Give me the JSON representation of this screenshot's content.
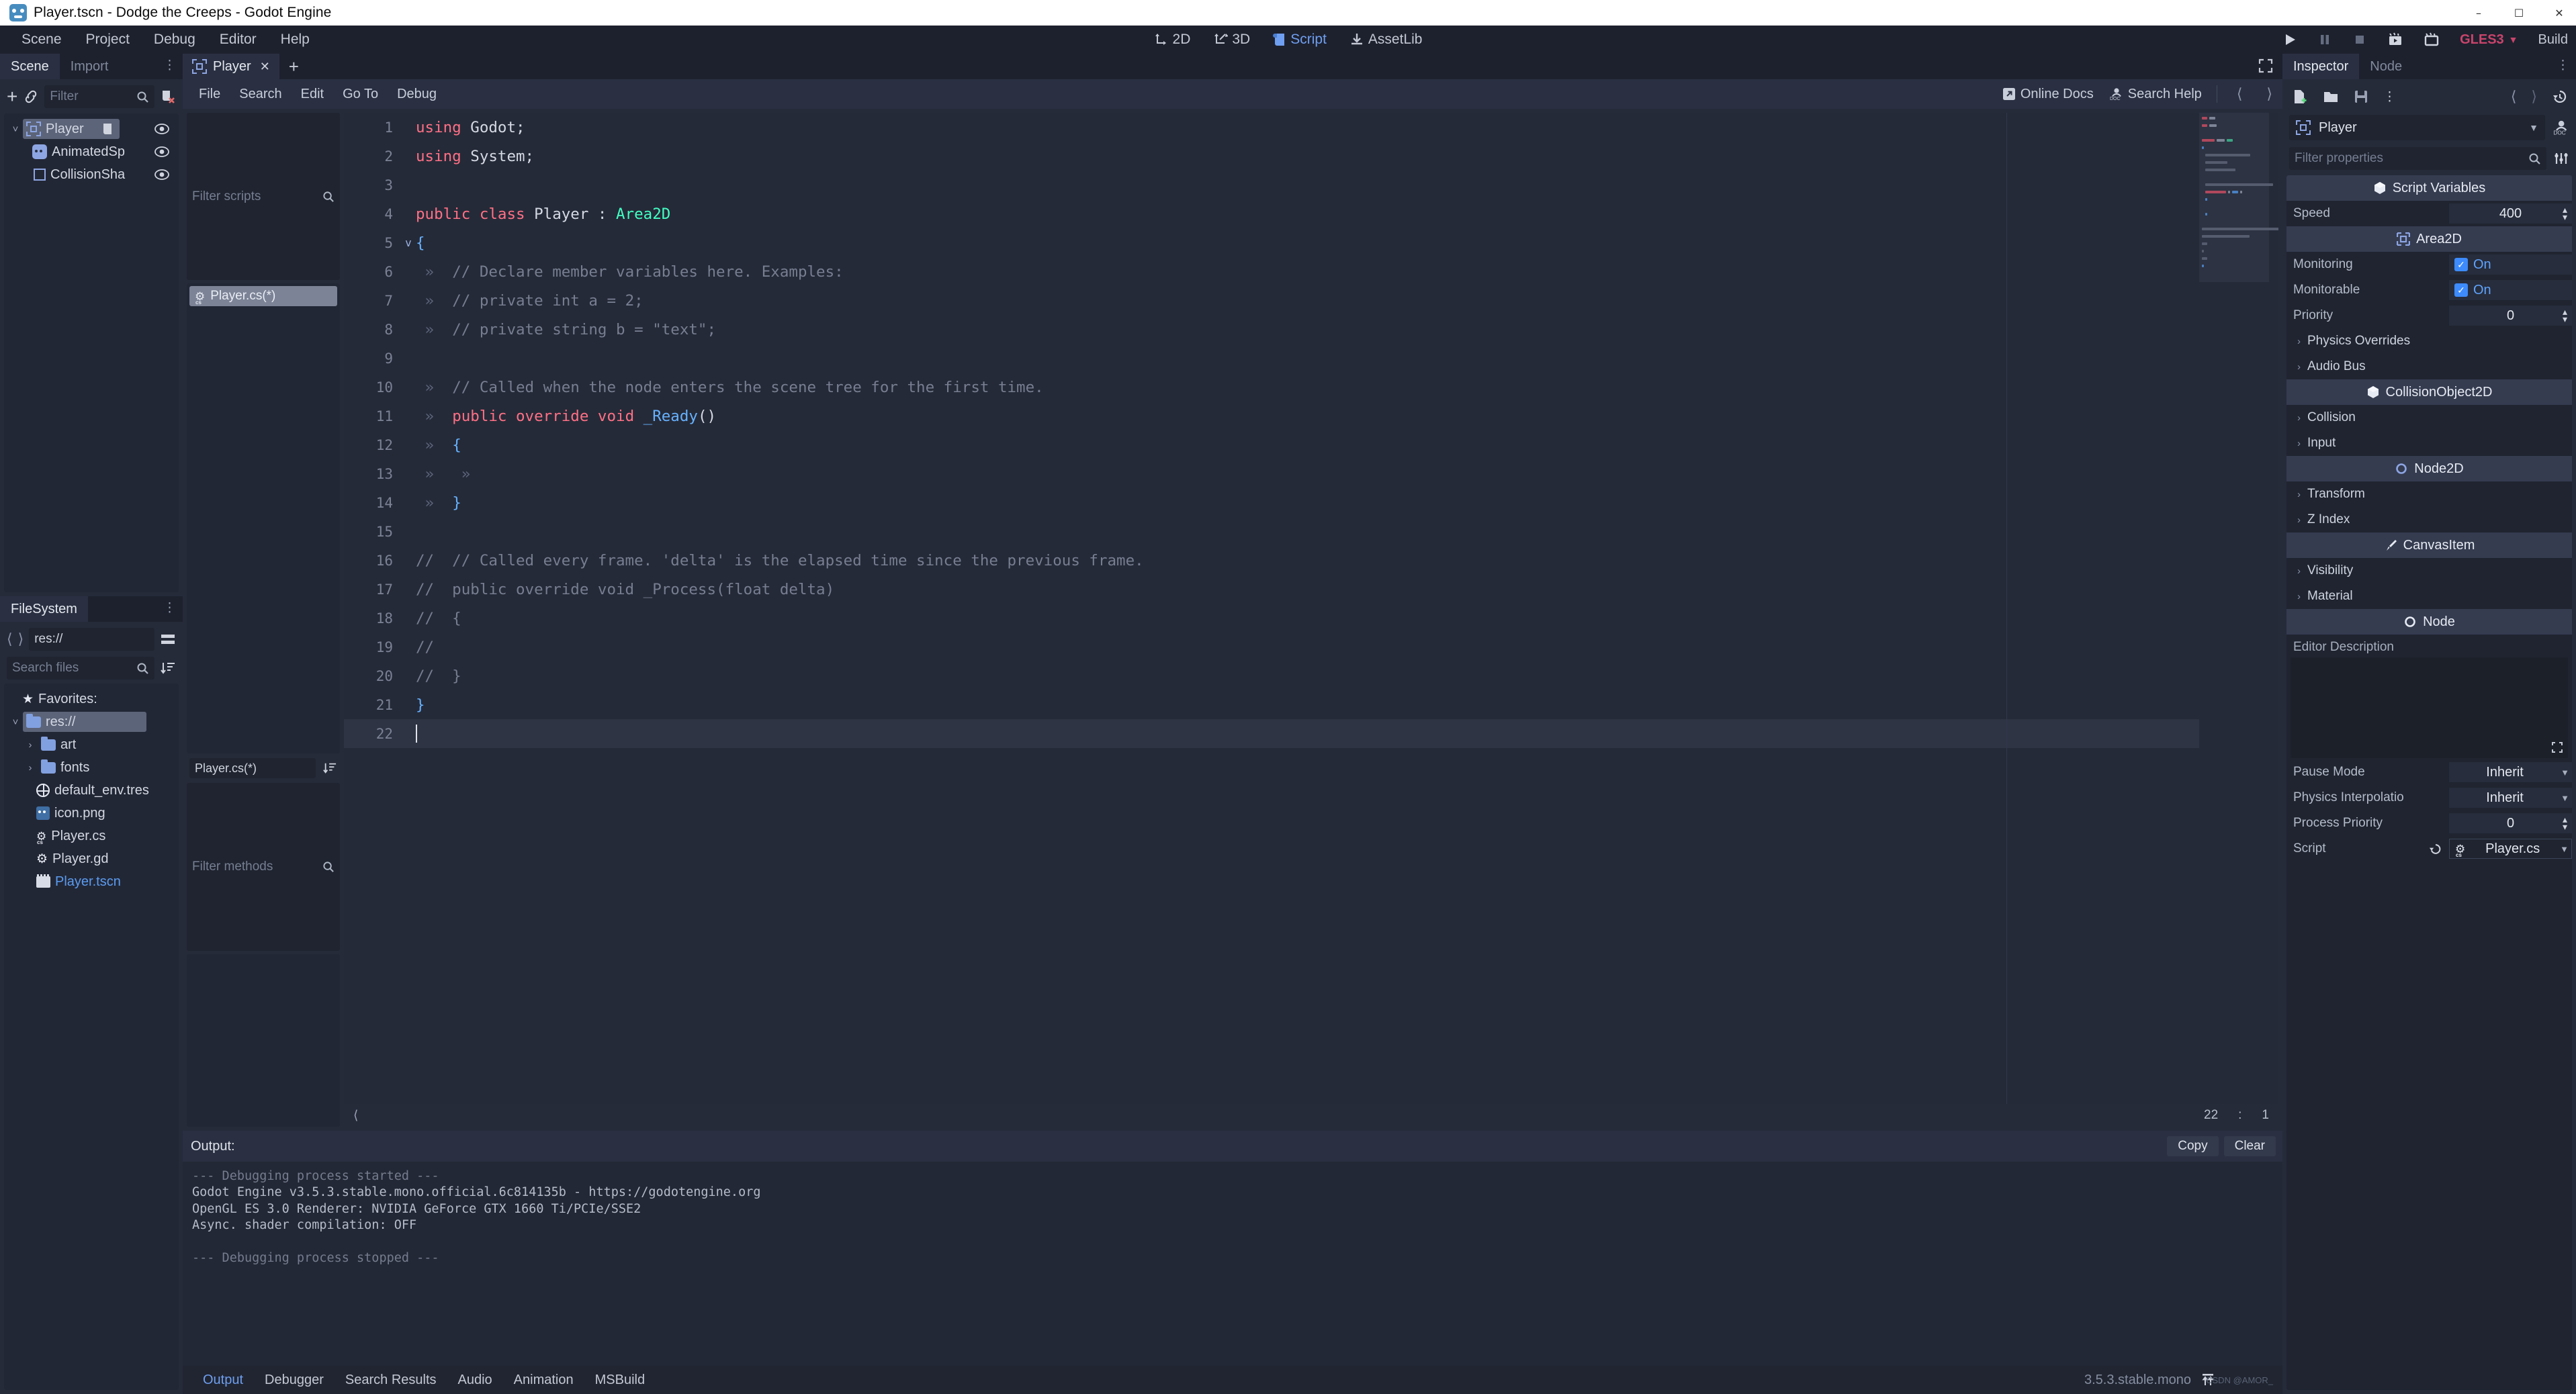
{
  "window": {
    "title": "Player.tscn - Dodge the Creeps - Godot Engine",
    "minimize": "–",
    "maximize": "☐",
    "close": "✕"
  },
  "menubar": {
    "items": [
      "Scene",
      "Project",
      "Debug",
      "Editor",
      "Help"
    ],
    "modes": [
      {
        "label": "2D",
        "icon": "move-2d-icon",
        "active": false
      },
      {
        "label": "3D",
        "icon": "move-3d-icon",
        "active": false
      },
      {
        "label": "Script",
        "icon": "script-icon",
        "active": true
      },
      {
        "label": "AssetLib",
        "icon": "download-icon",
        "active": false
      }
    ],
    "play_controls": [
      {
        "name": "play-button",
        "glyph": "▶"
      },
      {
        "name": "pause-button",
        "glyph": "▐▌"
      },
      {
        "name": "stop-button",
        "glyph": "■"
      },
      {
        "name": "play-scene-button",
        "glyph": "▶"
      },
      {
        "name": "play-custom-scene-button",
        "glyph": "□"
      }
    ],
    "renderer": "GLES3",
    "build_label": "Build"
  },
  "scene_dock": {
    "tabs": [
      {
        "label": "Scene",
        "active": true
      },
      {
        "label": "Import",
        "active": false
      }
    ],
    "filter_placeholder": "Filter",
    "nodes": [
      {
        "label": "Player",
        "icon": "area2d-icon",
        "selected": true,
        "depth": 0,
        "has_script": true
      },
      {
        "label": "AnimatedSp",
        "icon": "animated-sprite-icon",
        "selected": false,
        "depth": 1,
        "has_script": false
      },
      {
        "label": "CollisionSha",
        "icon": "collision-shape-icon",
        "selected": false,
        "depth": 1,
        "has_script": false
      }
    ]
  },
  "filesystem_dock": {
    "tab": "FileSystem",
    "path": "res://",
    "search_placeholder": "Search files",
    "favorites_label": "Favorites:",
    "entries": [
      {
        "label": "res://",
        "type": "folder",
        "depth": 0,
        "selected": true,
        "expanded": true
      },
      {
        "label": "art",
        "type": "folder",
        "depth": 1,
        "selected": false,
        "expanded": false
      },
      {
        "label": "fonts",
        "type": "folder",
        "depth": 1,
        "selected": false,
        "expanded": false
      },
      {
        "label": "default_env.tres",
        "type": "resource",
        "depth": 1,
        "selected": false
      },
      {
        "label": "icon.png",
        "type": "image",
        "depth": 1,
        "selected": false
      },
      {
        "label": "Player.cs",
        "type": "csharp",
        "depth": 1,
        "selected": false
      },
      {
        "label": "Player.gd",
        "type": "gdscript",
        "depth": 1,
        "selected": false
      },
      {
        "label": "Player.tscn",
        "type": "scene",
        "depth": 1,
        "selected": false,
        "highlight": true
      }
    ]
  },
  "script_editor": {
    "tab_label": "Player",
    "menus": [
      "File",
      "Search",
      "Edit",
      "Go To",
      "Debug"
    ],
    "online_docs": "Online Docs",
    "search_help": "Search Help",
    "filter_scripts_placeholder": "Filter scripts",
    "open_scripts": [
      {
        "label": "Player.cs(*)",
        "selected": true
      }
    ],
    "members_selected": "Player.cs(*)",
    "filter_methods_placeholder": "Filter methods",
    "caret_line": "22",
    "caret_sep": ":",
    "caret_column": "1",
    "lines": [
      {
        "n": "1",
        "fold": "",
        "tabs": 0,
        "tokens": [
          {
            "t": "using",
            "c": "kw"
          },
          {
            "t": " Godot;",
            "c": "pn"
          }
        ]
      },
      {
        "n": "2",
        "fold": "",
        "tabs": 0,
        "tokens": [
          {
            "t": "using",
            "c": "kw"
          },
          {
            "t": " System;",
            "c": "pn"
          }
        ]
      },
      {
        "n": "3",
        "fold": "",
        "tabs": 0,
        "tokens": []
      },
      {
        "n": "4",
        "fold": "",
        "tabs": 0,
        "tokens": [
          {
            "t": "public class",
            "c": "kw"
          },
          {
            "t": " Player : ",
            "c": "pn"
          },
          {
            "t": "Area2D",
            "c": "ty"
          }
        ]
      },
      {
        "n": "5",
        "fold": "v",
        "tabs": 0,
        "tokens": [
          {
            "t": "{",
            "c": "fn"
          }
        ]
      },
      {
        "n": "6",
        "fold": "",
        "tabs": 1,
        "tokens": [
          {
            "t": "// Declare member variables here. Examples:",
            "c": "cm"
          }
        ]
      },
      {
        "n": "7",
        "fold": "",
        "tabs": 1,
        "tokens": [
          {
            "t": "// private int a = 2;",
            "c": "cm"
          }
        ]
      },
      {
        "n": "8",
        "fold": "",
        "tabs": 1,
        "tokens": [
          {
            "t": "// private string b = \"text\";",
            "c": "cm"
          }
        ]
      },
      {
        "n": "9",
        "fold": "",
        "tabs": 0,
        "tokens": []
      },
      {
        "n": "10",
        "fold": "",
        "tabs": 1,
        "tokens": [
          {
            "t": "// Called when the node enters the scene tree for the first time.",
            "c": "cm"
          }
        ]
      },
      {
        "n": "11",
        "fold": "",
        "tabs": 1,
        "tokens": [
          {
            "t": "public override void",
            "c": "kw"
          },
          {
            "t": " ",
            "c": "pn"
          },
          {
            "t": "_Ready",
            "c": "fn"
          },
          {
            "t": "()",
            "c": "pn"
          }
        ]
      },
      {
        "n": "12",
        "fold": "",
        "tabs": 1,
        "tokens": [
          {
            "t": "{",
            "c": "fn"
          }
        ]
      },
      {
        "n": "13",
        "fold": "",
        "tabs": 2,
        "tokens": []
      },
      {
        "n": "14",
        "fold": "",
        "tabs": 1,
        "tokens": [
          {
            "t": "}",
            "c": "fn"
          }
        ]
      },
      {
        "n": "15",
        "fold": "",
        "tabs": 0,
        "tokens": []
      },
      {
        "n": "16",
        "fold": "",
        "tabs": 0,
        "tokens": [
          {
            "t": "//  // Called every frame. 'delta' is the elapsed time since the previous frame.",
            "c": "cm"
          }
        ]
      },
      {
        "n": "17",
        "fold": "",
        "tabs": 0,
        "tokens": [
          {
            "t": "//  public override void _Process(float delta)",
            "c": "cm"
          }
        ]
      },
      {
        "n": "18",
        "fold": "",
        "tabs": 0,
        "tokens": [
          {
            "t": "//  {",
            "c": "cm"
          }
        ]
      },
      {
        "n": "19",
        "fold": "",
        "tabs": 0,
        "tokens": [
          {
            "t": "//",
            "c": "cm"
          }
        ]
      },
      {
        "n": "20",
        "fold": "",
        "tabs": 0,
        "tokens": [
          {
            "t": "//  }",
            "c": "cm"
          }
        ]
      },
      {
        "n": "21",
        "fold": "",
        "tabs": 0,
        "tokens": [
          {
            "t": "}",
            "c": "fn"
          }
        ]
      },
      {
        "n": "22",
        "fold": "",
        "tabs": 0,
        "current": true,
        "tokens": [],
        "caret": true
      }
    ]
  },
  "inspector": {
    "tabs": [
      {
        "label": "Inspector",
        "active": true
      },
      {
        "label": "Node",
        "active": false
      }
    ],
    "node_name": "Player",
    "filter_placeholder": "Filter properties",
    "sections": [
      {
        "kind": "category",
        "label": "Script Variables",
        "icon": "box-icon"
      },
      {
        "kind": "prop",
        "label": "Speed",
        "value": "400",
        "control": "spin"
      },
      {
        "kind": "category",
        "label": "Area2D",
        "icon": "area2d-icon"
      },
      {
        "kind": "prop",
        "label": "Monitoring",
        "value": "On",
        "control": "checkbox",
        "checked": true
      },
      {
        "kind": "prop",
        "label": "Monitorable",
        "value": "On",
        "control": "checkbox",
        "checked": true
      },
      {
        "kind": "prop",
        "label": "Priority",
        "value": "0",
        "control": "spin"
      },
      {
        "kind": "sub",
        "label": "Physics Overrides"
      },
      {
        "kind": "sub",
        "label": "Audio Bus"
      },
      {
        "kind": "category",
        "label": "CollisionObject2D",
        "icon": "box-icon"
      },
      {
        "kind": "sub",
        "label": "Collision"
      },
      {
        "kind": "sub",
        "label": "Input"
      },
      {
        "kind": "category",
        "label": "Node2D",
        "icon": "node2d-icon"
      },
      {
        "kind": "sub",
        "label": "Transform"
      },
      {
        "kind": "sub",
        "label": "Z Index"
      },
      {
        "kind": "category",
        "label": "CanvasItem",
        "icon": "brush-icon"
      },
      {
        "kind": "sub",
        "label": "Visibility"
      },
      {
        "kind": "sub",
        "label": "Material"
      },
      {
        "kind": "category",
        "label": "Node",
        "icon": "node-icon"
      }
    ],
    "editor_description_label": "Editor Description",
    "editor_description_value": "",
    "bottom_props": [
      {
        "label": "Pause Mode",
        "value": "Inherit",
        "control": "dropdown"
      },
      {
        "label": "Physics Interpolatio",
        "value": "Inherit",
        "control": "dropdown"
      },
      {
        "label": "Process Priority",
        "value": "0",
        "control": "spin"
      },
      {
        "label": "Script",
        "value": "Player.cs",
        "control": "script"
      }
    ]
  },
  "output": {
    "title": "Output:",
    "copy_label": "Copy",
    "clear_label": "Clear",
    "lines": [
      {
        "text": "--- Debugging process started ---",
        "dim": true
      },
      {
        "text": "Godot Engine v3.5.3.stable.mono.official.6c814135b - https://godotengine.org",
        "dim": false
      },
      {
        "text": "OpenGL ES 3.0 Renderer: NVIDIA GeForce GTX 1660 Ti/PCIe/SSE2",
        "dim": false
      },
      {
        "text": "Async. shader compilation: OFF",
        "dim": false
      },
      {
        "text": "",
        "dim": false
      },
      {
        "text": "--- Debugging process stopped ---",
        "dim": true
      }
    ]
  },
  "bottom_bar": {
    "tabs": [
      {
        "label": "Output",
        "active": true
      },
      {
        "label": "Debugger",
        "active": false
      },
      {
        "label": "Search Results",
        "active": false
      },
      {
        "label": "Audio",
        "active": false
      },
      {
        "label": "Animation",
        "active": false
      },
      {
        "label": "MSBuild",
        "active": false
      }
    ],
    "version": "3.5.3.stable.mono",
    "watermark": "CSDN @AMOR_"
  },
  "colors": {
    "accent": "#6f9ff0",
    "keyword": "#ff7085",
    "type": "#42ffc2",
    "function": "#66b2ff",
    "comment": "#777e90",
    "renderer": "#c9446b",
    "panel": "#262b3a",
    "editor_bg": "#252a38"
  }
}
